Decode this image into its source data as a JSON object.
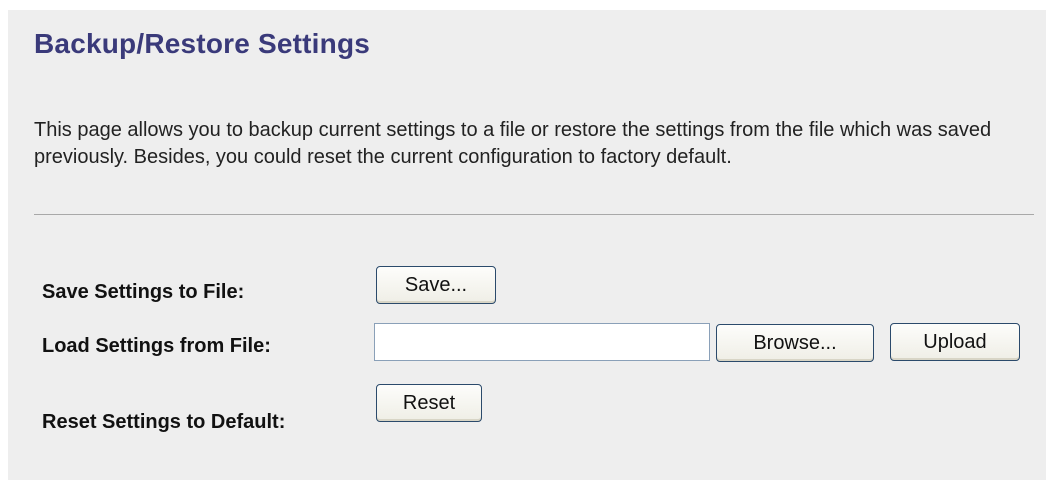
{
  "header": {
    "title": "Backup/Restore Settings"
  },
  "description": "This page allows you to backup current settings to a file or restore the settings from the file which was saved previously. Besides, you could reset the current configuration to factory default.",
  "rows": {
    "save": {
      "label": "Save Settings to File:",
      "button": "Save..."
    },
    "load": {
      "label": "Load Settings from File:",
      "file_value": "",
      "browse_button": "Browse...",
      "upload_button": "Upload"
    },
    "reset": {
      "label": "Reset Settings to Default:",
      "button": "Reset"
    }
  },
  "colors": {
    "title": "#3a3a7a",
    "panel_background": "#eeeeee",
    "button_border": "#2b4a6b"
  }
}
